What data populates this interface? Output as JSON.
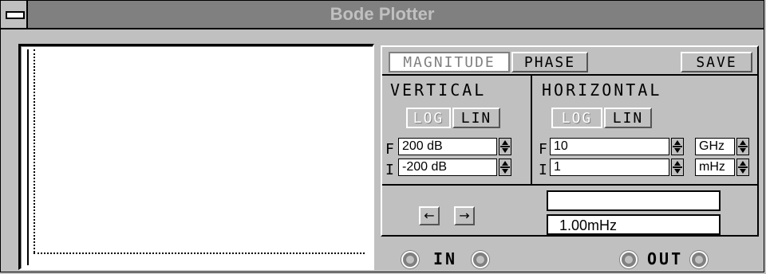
{
  "window": {
    "title": "Bode Plotter"
  },
  "mode": {
    "magnitude_label": "MAGNITUDE",
    "phase_label": "PHASE",
    "save_label": "SAVE",
    "active": "MAGNITUDE"
  },
  "vertical": {
    "label": "VERTICAL",
    "log_label": "LOG",
    "lin_label": "LIN",
    "scale": "LOG",
    "final_label": "F",
    "initial_label": "I",
    "final_value": "200 dB",
    "initial_value": "-200 dB"
  },
  "horizontal": {
    "label": "HORIZONTAL",
    "log_label": "LOG",
    "lin_label": "LIN",
    "scale": "LOG",
    "final_label": "F",
    "initial_label": "I",
    "final_value": "10",
    "final_unit": "GHz",
    "initial_value": "1",
    "initial_unit": "mHz"
  },
  "cursor": {
    "left_arrow": "←",
    "right_arrow": "→",
    "value_readout": "",
    "frequency_readout": "1.00mHz"
  },
  "terminals": {
    "in_label": "IN",
    "out_label": "OUT"
  }
}
